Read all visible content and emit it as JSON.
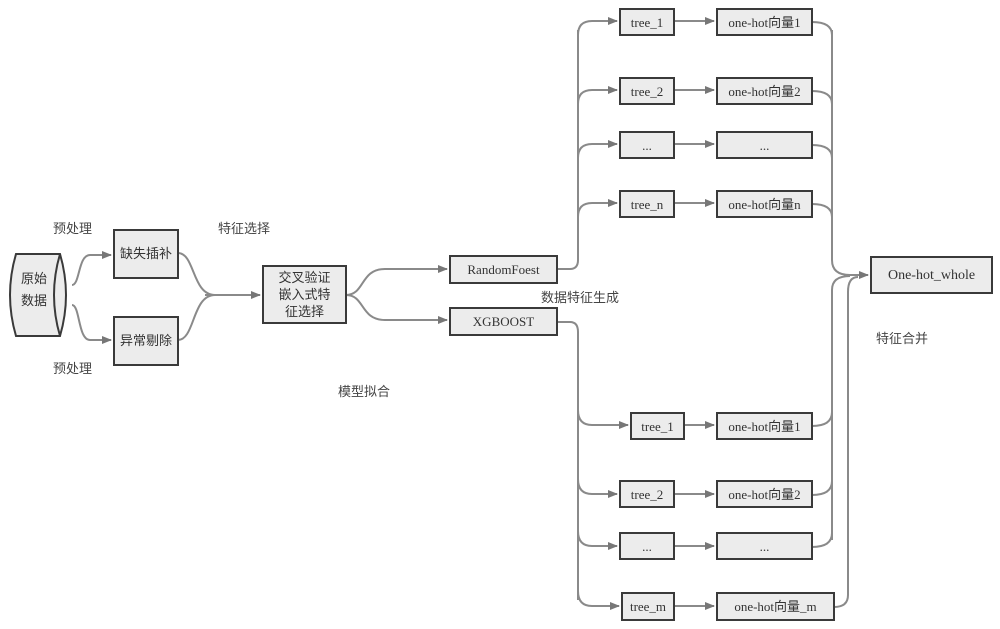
{
  "diagram": {
    "source": {
      "label_line1": "原始",
      "label_line2": "数据"
    },
    "preprocess": {
      "label_top": "预处理",
      "label_bottom": "预处理",
      "missing_fill": "缺失插补",
      "outlier_remove": "异常剔除"
    },
    "feature_selection": {
      "label": "特征选择",
      "box_line1": "交叉验证",
      "box_line2": "嵌入式特",
      "box_line3": "征选择"
    },
    "model_fit": {
      "label": "模型拟合",
      "random_forest": "RandomFoest",
      "xgboost": "XGBOOST"
    },
    "feature_gen": {
      "label": "数据特征生成"
    },
    "rf_branches": [
      {
        "tree": "tree_1",
        "vector": "one-hot向量1"
      },
      {
        "tree": "tree_2",
        "vector": "one-hot向量2"
      },
      {
        "tree": "...",
        "vector": "..."
      },
      {
        "tree": "tree_n",
        "vector": "one-hot向量n"
      }
    ],
    "xgb_branches": [
      {
        "tree": "tree_1",
        "vector": "one-hot向量1"
      },
      {
        "tree": "tree_2",
        "vector": "one-hot向量2"
      },
      {
        "tree": "...",
        "vector": "..."
      },
      {
        "tree": "tree_m",
        "vector": "one-hot向量_m"
      }
    ],
    "merge": {
      "label": "特征合并",
      "output": "One-hot_whole"
    }
  }
}
